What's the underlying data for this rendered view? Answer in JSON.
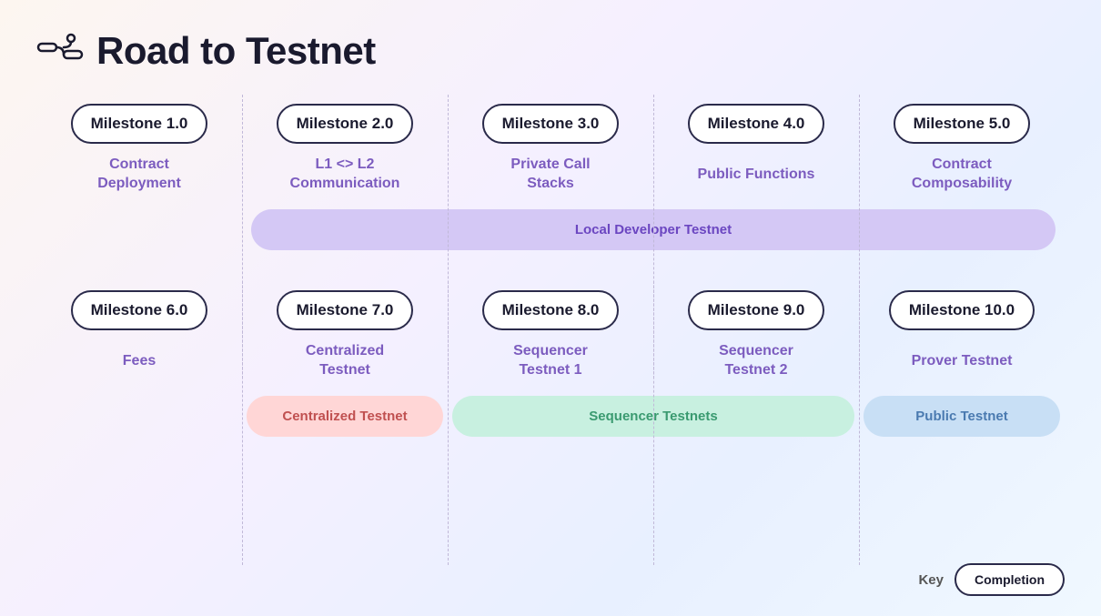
{
  "page": {
    "title": "Road to Testnet",
    "icon_label": "route-icon"
  },
  "row1": {
    "milestones": [
      {
        "id": "m1",
        "badge": "Milestone 1.0",
        "label": "Contract\nDeployment"
      },
      {
        "id": "m2",
        "badge": "Milestone 2.0",
        "label": "L1 <> L2\nCommunication"
      },
      {
        "id": "m3",
        "badge": "Milestone 3.0",
        "label": "Private Call\nStacks"
      },
      {
        "id": "m4",
        "badge": "Milestone 4.0",
        "label": "Public Functions"
      },
      {
        "id": "m5",
        "badge": "Milestone 5.0",
        "label": "Contract\nComposability"
      }
    ],
    "banner": {
      "text": "Local Developer Testnet",
      "theme": "purple"
    }
  },
  "row2": {
    "milestones": [
      {
        "id": "m6",
        "badge": "Milestone 6.0",
        "label": "Fees"
      },
      {
        "id": "m7",
        "badge": "Milestone 7.0",
        "label": "Centralized\nTestnet"
      },
      {
        "id": "m8",
        "badge": "Milestone 8.0",
        "label": "Sequencer\nTestnet 1"
      },
      {
        "id": "m9",
        "badge": "Milestone 9.0",
        "label": "Sequencer\nTestnet 2"
      },
      {
        "id": "m10",
        "badge": "Milestone 10.0",
        "label": "Prover Testnet"
      }
    ],
    "banners": [
      {
        "text": "Centralized Testnet",
        "theme": "pink",
        "col_start": 2,
        "col_end": 3
      },
      {
        "text": "Sequencer Testnets",
        "theme": "green",
        "col_start": 3,
        "col_end": 5
      },
      {
        "text": "Public Testnet",
        "theme": "blue",
        "col_start": 5,
        "col_end": 6
      }
    ]
  },
  "key": {
    "label": "Key",
    "completion_label": "Completion"
  }
}
